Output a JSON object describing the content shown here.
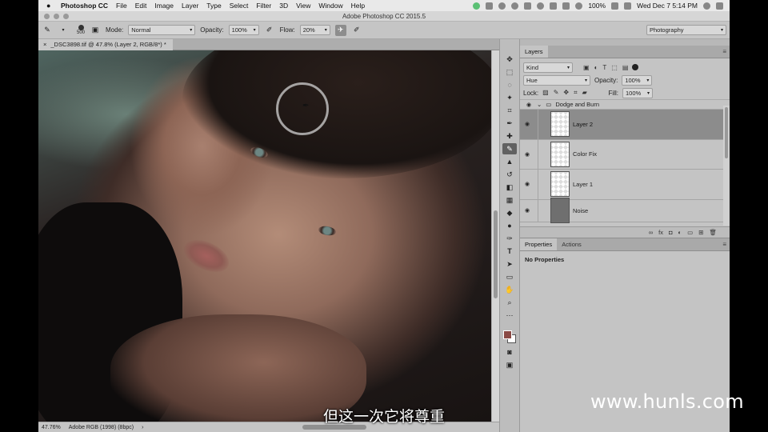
{
  "menubar": {
    "app": "Photoshop CC",
    "items": [
      "File",
      "Edit",
      "Image",
      "Layer",
      "Type",
      "Select",
      "Filter",
      "3D",
      "View",
      "Window",
      "Help"
    ],
    "battery": "100%",
    "datetime": "Wed Dec 7  5:14 PM"
  },
  "window": {
    "title": "Adobe Photoshop CC 2015.5"
  },
  "options": {
    "brush_size": "500",
    "mode_label": "Mode:",
    "mode_value": "Normal",
    "opacity_label": "Opacity:",
    "opacity_value": "100%",
    "flow_label": "Flow:",
    "flow_value": "20%",
    "workspace": "Photography"
  },
  "document": {
    "tab": "_DSC3898.tif @ 47.8% (Layer 2, RGB/8*) *",
    "zoom": "47.76%",
    "profile": "Adobe RGB (1998) (8bpc)"
  },
  "layers_panel": {
    "tab": "Layers",
    "filter_kind": "Kind",
    "blend_mode": "Hue",
    "opacity_label": "Opacity:",
    "opacity": "100%",
    "lock_label": "Lock:",
    "fill_label": "Fill:",
    "fill": "100%",
    "group": "Dodge and Burn",
    "layers": [
      {
        "name": "Layer 2",
        "selected": true
      },
      {
        "name": "Color Fix",
        "selected": false
      },
      {
        "name": "Layer 1",
        "selected": false
      },
      {
        "name": "Noise",
        "selected": false
      }
    ]
  },
  "properties_panel": {
    "tab1": "Properties",
    "tab2": "Actions",
    "empty": "No Properties"
  },
  "overlay": {
    "subtitle": "但这一次它将尊重",
    "watermark": "www.hunls.com"
  },
  "colors": {
    "foreground": "#8a4a45",
    "background": "#ffffff",
    "accent": "#8c8c8c"
  }
}
